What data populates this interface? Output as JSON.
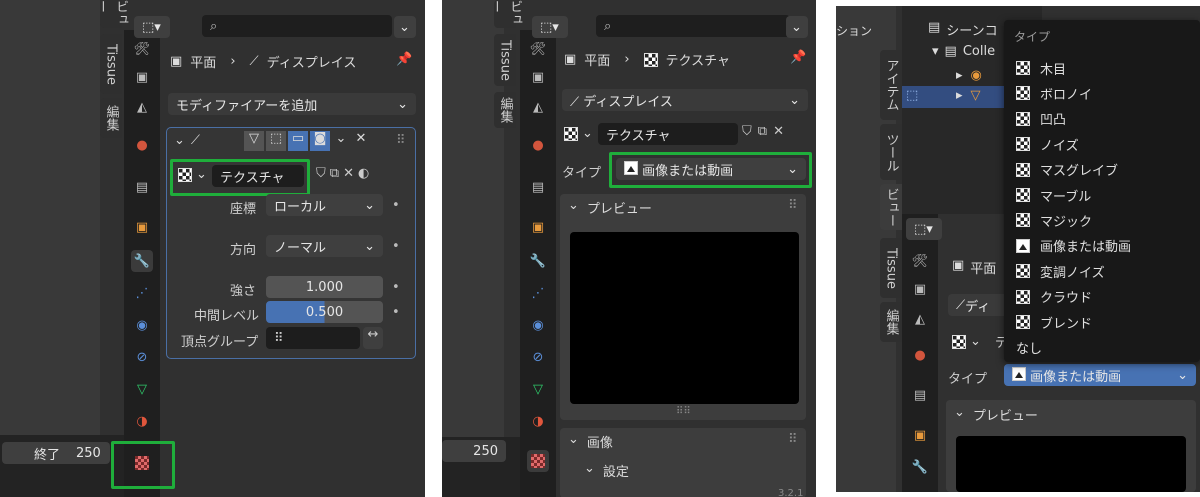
{
  "panel1": {
    "vtabs": [
      "ビュー",
      "Tissue",
      "編集"
    ],
    "breadcrumb": {
      "object": "平面",
      "modifier": "ディスプレイス"
    },
    "add_modifier": "モディファイアーを追加",
    "texture_name": "テクスチャ",
    "coords_label": "座標",
    "coords_value": "ローカル",
    "direction_label": "方向",
    "direction_value": "ノーマル",
    "strength_label": "強さ",
    "strength_value": "1.000",
    "midlevel_label": "中間レベル",
    "midlevel_value": "0.500",
    "vgroup_label": "頂点グループ",
    "timeline_end_label": "終了",
    "timeline_end_value": "250"
  },
  "panel2": {
    "vtabs": [
      "ビュー",
      "Tissue",
      "編集"
    ],
    "breadcrumb": {
      "object": "平面",
      "texture": "テクスチャ"
    },
    "displace_field": "ディスプレイス",
    "texture_name": "テクスチャ",
    "type_label": "タイプ",
    "type_value": "画像または動画",
    "preview_label": "プレビュー",
    "image_label": "画像",
    "settings_label": "設定",
    "timeline_value": "250",
    "version": "3.2.1"
  },
  "panel3": {
    "header_partial": "ション",
    "outliner_scene": "シーンコ",
    "outliner_collection": "Colle",
    "vtabs": [
      "アイテム",
      "ツール",
      "ビュー",
      "Tissue",
      "編集"
    ],
    "object_partial": "平面",
    "displace_partial": "ディ",
    "texture_partial": "テ",
    "type_label": "タイプ",
    "type_value": "画像または動画",
    "preview_label": "プレビュー",
    "dropdown": {
      "title": "タイプ",
      "items": [
        "木目",
        "ボロノイ",
        "凹凸",
        "ノイズ",
        "マスグレイブ",
        "マーブル",
        "マジック",
        "画像または動画",
        "変調ノイズ",
        "クラウド",
        "ブレンド",
        "なし"
      ]
    }
  },
  "colors": {
    "highlight": "#1fae3b",
    "accent_blue": "#4772b3",
    "modifier_box_border": "#4a6fa5"
  }
}
